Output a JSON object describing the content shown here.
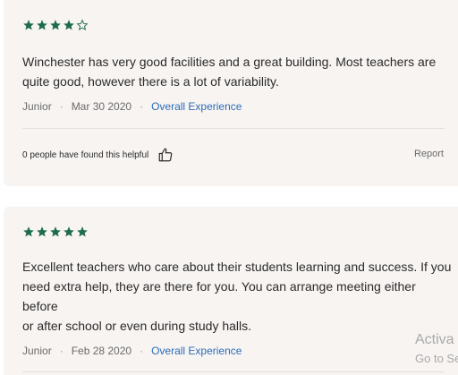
{
  "colors": {
    "star_fill": "#1e6b4e",
    "link": "#2c6db8",
    "card_bg": "#f7f4f2"
  },
  "reviews": [
    {
      "rating": 4,
      "max_rating": 5,
      "text_lines": [
        "Winchester has very good facilities and a great building. Most teachers are",
        "quite good, however there is a lot of variability."
      ],
      "author": "Junior",
      "date": "Mar 30 2020",
      "category": "Overall Experience",
      "helpful_text": "0 people have found this helpful",
      "helpful_icon": "thumbs-up-icon",
      "report_label": "Report"
    },
    {
      "rating": 5,
      "max_rating": 5,
      "text_lines": [
        "Excellent teachers who care about their students learning and success. If you",
        "need extra help, they are there for you. You can arrange meeting either",
        "before",
        "or after school or even during study halls."
      ],
      "author": "Junior",
      "date": "Feb 28 2020",
      "category": "Overall Experience"
    }
  ],
  "watermark": {
    "line1": "Activa",
    "line2": "Go to Se"
  }
}
